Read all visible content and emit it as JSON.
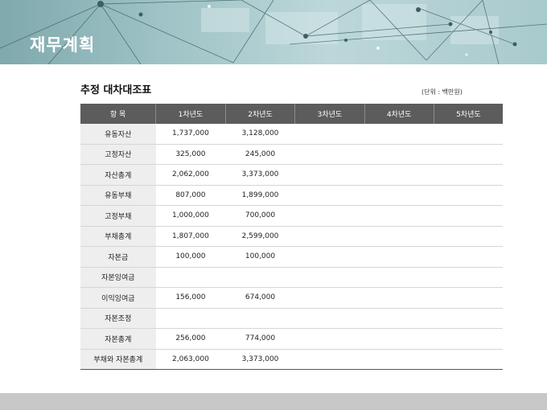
{
  "header": {
    "title": "재무계획"
  },
  "table": {
    "title": "추정 대차대조표",
    "unit": "(단위 : 백만원)",
    "columns": [
      "항 목",
      "1차년도",
      "2차년도",
      "3차년도",
      "4차년도",
      "5차년도"
    ],
    "rows": [
      {
        "label": "유동자산",
        "values": [
          "1,737,000",
          "3,128,000",
          "",
          "",
          ""
        ]
      },
      {
        "label": "고정자산",
        "values": [
          "325,000",
          "245,000",
          "",
          "",
          ""
        ]
      },
      {
        "label": "자산총계",
        "values": [
          "2,062,000",
          "3,373,000",
          "",
          "",
          ""
        ]
      },
      {
        "label": "유동부채",
        "values": [
          "807,000",
          "1,899,000",
          "",
          "",
          ""
        ]
      },
      {
        "label": "고정부채",
        "values": [
          "1,000,000",
          "700,000",
          "",
          "",
          ""
        ]
      },
      {
        "label": "부채총계",
        "values": [
          "1,807,000",
          "2,599,000",
          "",
          "",
          ""
        ]
      },
      {
        "label": "자본금",
        "values": [
          "100,000",
          "100,000",
          "",
          "",
          ""
        ]
      },
      {
        "label": "자본잉여금",
        "values": [
          "",
          "",
          "",
          "",
          ""
        ]
      },
      {
        "label": "이익잉여금",
        "values": [
          "156,000",
          "674,000",
          "",
          "",
          ""
        ]
      },
      {
        "label": "자본조정",
        "values": [
          "",
          "",
          "",
          "",
          ""
        ]
      },
      {
        "label": "자본총계",
        "values": [
          "256,000",
          "774,000",
          "",
          "",
          ""
        ]
      },
      {
        "label": "부채와 자본총계",
        "values": [
          "2,063,000",
          "3,373,000",
          "",
          "",
          ""
        ]
      }
    ]
  }
}
